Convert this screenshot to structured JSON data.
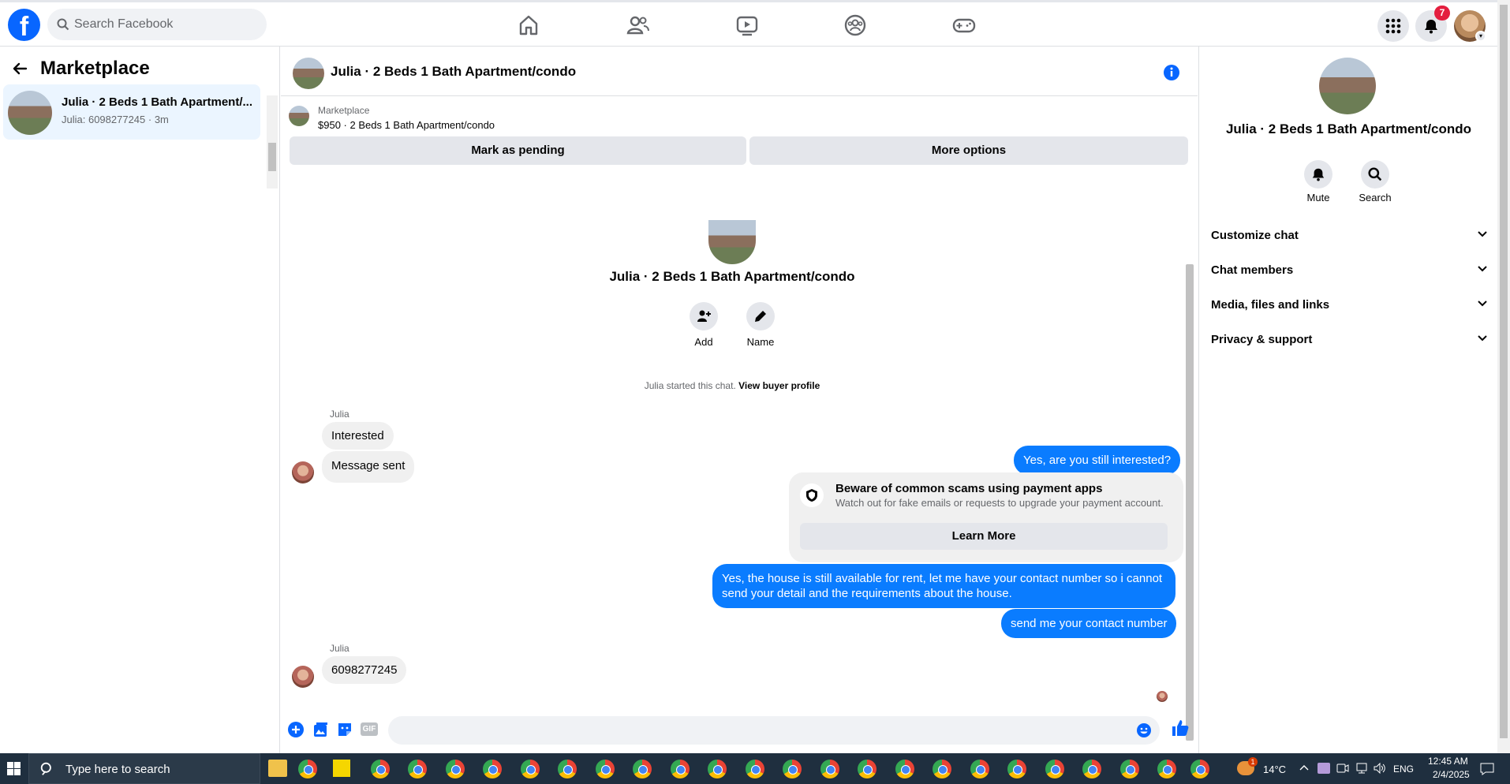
{
  "topbar": {
    "logo": "f",
    "search_placeholder": "Search Facebook",
    "notification_count": "7",
    "nav_icons": [
      "home-icon",
      "friends-icon",
      "watch-icon",
      "groups-icon",
      "gaming-icon"
    ],
    "right_icons": [
      "menu-grid-icon",
      "bell-icon"
    ]
  },
  "sidebar": {
    "title": "Marketplace",
    "conversation": {
      "title": "Julia · 2 Beds 1 Bath Apartment/...",
      "subtitle": "Julia: 6098277245 · 3m"
    }
  },
  "chat": {
    "header_title": "Julia · 2 Beds 1 Bath Apartment/condo",
    "listing_label": "Marketplace",
    "listing_price": "$950 · 2 Beds 1 Bath Apartment/condo",
    "mark_pending": "Mark as pending",
    "more_options": "More options",
    "center_title": "Julia · 2 Beds 1 Bath Apartment/condo",
    "add_label": "Add",
    "name_label": "Name",
    "started_text": "Julia started this chat.",
    "view_buyer": "View buyer profile",
    "sender_name": "Julia",
    "msg_interested": "Interested",
    "msg_sent": "Message sent",
    "out_1": "Yes, are you still interested?",
    "warning_title": "Beware of common scams using payment apps",
    "warning_body": "Watch out for fake emails or requests to upgrade your payment account.",
    "learn_more": "Learn More",
    "out_2": "Yes, the house is still available for rent, let me have your contact number so i cannot send your detail and the requirements about the house.",
    "out_3": "send me your contact number",
    "sender_name_2": "Julia",
    "msg_phone": "6098277245",
    "gif_label": "GIF",
    "composer_placeholder": ""
  },
  "right_panel": {
    "title": "Julia · 2 Beds 1 Bath Apartment/condo",
    "mute": "Mute",
    "search": "Search",
    "sections": [
      "Customize chat",
      "Chat members",
      "Media, files and links",
      "Privacy & support"
    ]
  },
  "taskbar": {
    "search_text": "Type here to search",
    "temperature": "14°C",
    "language": "ENG",
    "time": "12:45 AM",
    "date": "2/4/2025",
    "weather_badge": "1"
  },
  "colors": {
    "brand": "#0866ff",
    "outgoing_bubble": "#0a7cff",
    "incoming_bubble": "#f0f0f0",
    "badge": "#e41e3f"
  }
}
